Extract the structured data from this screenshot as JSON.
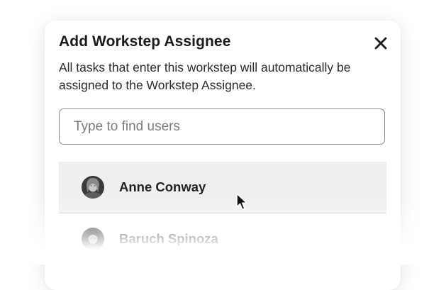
{
  "dialog": {
    "title": "Add Workstep Assignee",
    "description": "All tasks that enter this workstep will automatically be assigned to the Workstep Assignee.",
    "close_icon": "close-icon"
  },
  "search": {
    "placeholder": "Type to find users",
    "value": ""
  },
  "users": [
    {
      "name": "Anne Conway",
      "avatar": "portrait-avatar",
      "hovered": true
    },
    {
      "name": "Baruch Spinoza",
      "avatar": "portrait-avatar",
      "hovered": false
    }
  ],
  "colors": {
    "hover_row": "#efefef",
    "border": "#8a8a8a",
    "text": "#1f1f1f"
  }
}
